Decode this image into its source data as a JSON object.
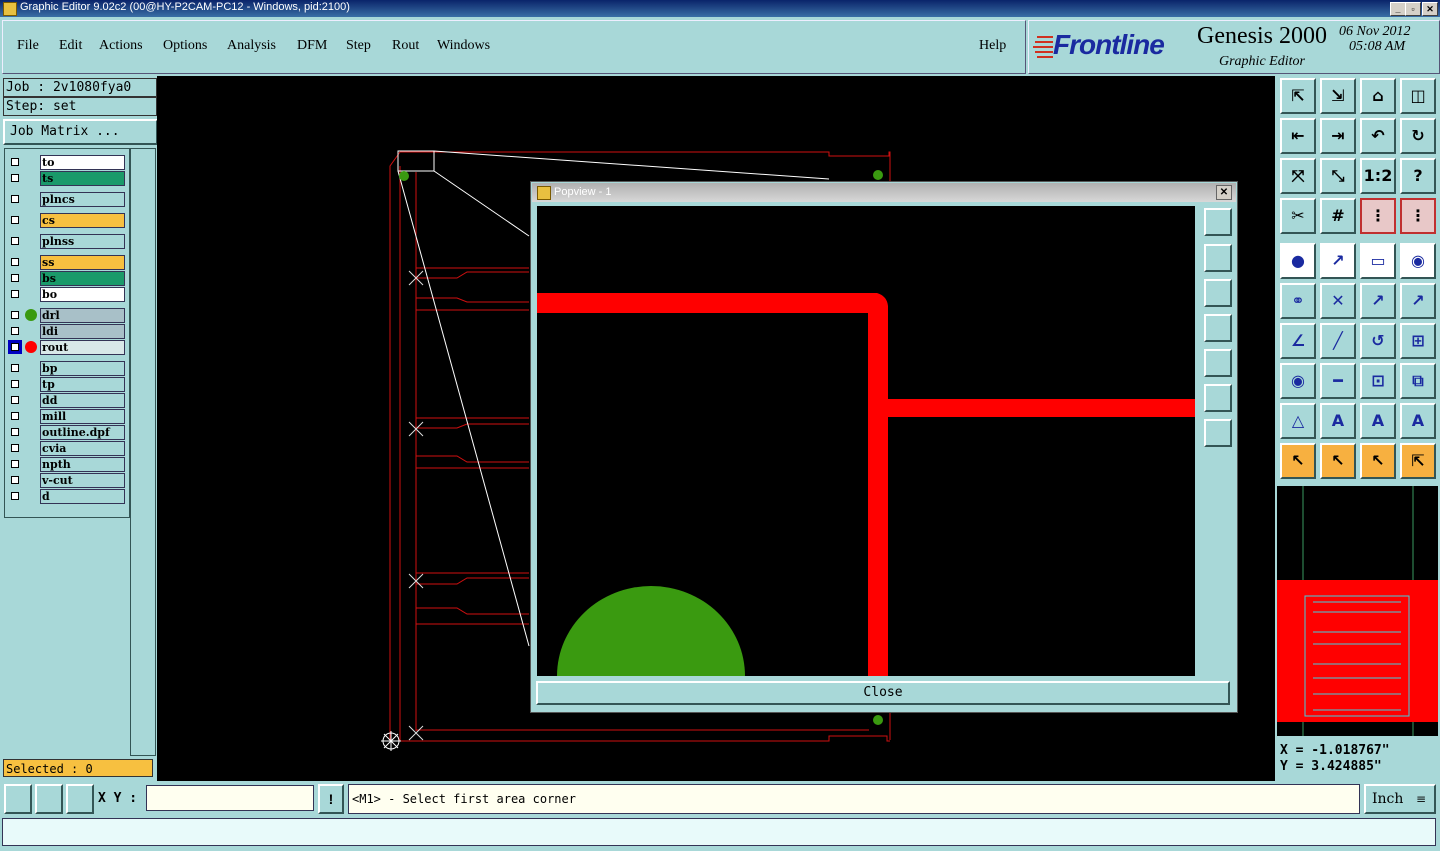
{
  "window": {
    "title": "Graphic Editor 9.02c2 (00@HY-P2CAM-PC12 - Windows, pid:2100)"
  },
  "menu": {
    "items": [
      "File",
      "Edit",
      "Actions",
      "Options",
      "Analysis",
      "DFM",
      "Step",
      "Rout",
      "Windows"
    ],
    "help": "Help"
  },
  "brand": {
    "logo": "Frontline",
    "product": "Genesis 2000",
    "subtitle": "Graphic Editor",
    "date": "06 Nov 2012",
    "time": "05:08 AM"
  },
  "job": {
    "job_label": "Job : 2v1080fya0",
    "step_label": "Step: set",
    "matrix_button": "Job Matrix ..."
  },
  "layers": [
    {
      "name": "to",
      "color": "#ffffff",
      "dot": null
    },
    {
      "name": "ts",
      "color": "#1a9a6a",
      "dot": null
    },
    {
      "name": "plncs",
      "color": "#a8d8d8",
      "dot": null
    },
    {
      "name": "cs",
      "color": "#f7c040",
      "dot": null
    },
    {
      "name": "plnss",
      "color": "#a8d8d8",
      "dot": null
    },
    {
      "name": "ss",
      "color": "#f7c040",
      "dot": null
    },
    {
      "name": "bs",
      "color": "#1a9a6a",
      "dot": null
    },
    {
      "name": "bo",
      "color": "#ffffff",
      "dot": null
    },
    {
      "name": "drl",
      "color": "#a8c0c8",
      "dot": "#3a9a10"
    },
    {
      "name": "ldi",
      "color": "#a8c0c8",
      "dot": null
    },
    {
      "name": "rout",
      "color": "#d8e8e8",
      "dot": "#ff0000"
    },
    {
      "name": "bp",
      "color": "#a8d8d8",
      "dot": null
    },
    {
      "name": "tp",
      "color": "#a8d8d8",
      "dot": null
    },
    {
      "name": "dd",
      "color": "#a8d8d8",
      "dot": null
    },
    {
      "name": "mill",
      "color": "#a8d8d8",
      "dot": null
    },
    {
      "name": "outline.dpf",
      "color": "#a8d8d8",
      "dot": null
    },
    {
      "name": "cvia",
      "color": "#a8d8d8",
      "dot": null
    },
    {
      "name": "npth",
      "color": "#a8d8d8",
      "dot": null
    },
    {
      "name": "v-cut",
      "color": "#a8d8d8",
      "dot": null
    },
    {
      "name": "d",
      "color": "#a8d8d8",
      "dot": null
    }
  ],
  "selected": "Selected : 0",
  "popview": {
    "title": "Popview - 1",
    "close_label": "Close"
  },
  "coords": {
    "x": "X = -1.018767\"",
    "y": "Y = 3.424885\""
  },
  "statusbar": {
    "xy_label": "X Y :",
    "xy_value": "",
    "exclaim": "!",
    "prompt": "<M1> - Select first area corner",
    "units": "Inch"
  },
  "colors": {
    "rout": "#ff0000",
    "drill": "#3a9a10",
    "panel": "#a8d8d8",
    "canvas": "#000000"
  },
  "icons": {
    "toolbar": [
      "zoom-home-icon",
      "zoom-fit-icon",
      "home-icon",
      "window-icon",
      "pan-left-icon",
      "pan-right-icon",
      "undo-view-icon",
      "redraw-icon",
      "zoom-in-icon",
      "zoom-out-icon",
      "scale-1-2-icon",
      "help-icon",
      "tools-icon",
      "grid-icon",
      "snap-icon",
      "snap2-icon",
      "pad-icon",
      "line-icon",
      "ruler-icon",
      "select-pad-icon",
      "connect-icon",
      "cross-icon",
      "move-icon",
      "move2-icon",
      "angle-icon",
      "line-draw-icon",
      "arc-icon",
      "feature-icon",
      "select-icon",
      "minus-icon",
      "measure-icon",
      "copy-icon",
      "triangle-icon",
      "text-icon",
      "text2-icon",
      "text3-icon",
      "pointer-icon",
      "pointer2-icon",
      "pointer3-icon",
      "route-icon"
    ]
  }
}
